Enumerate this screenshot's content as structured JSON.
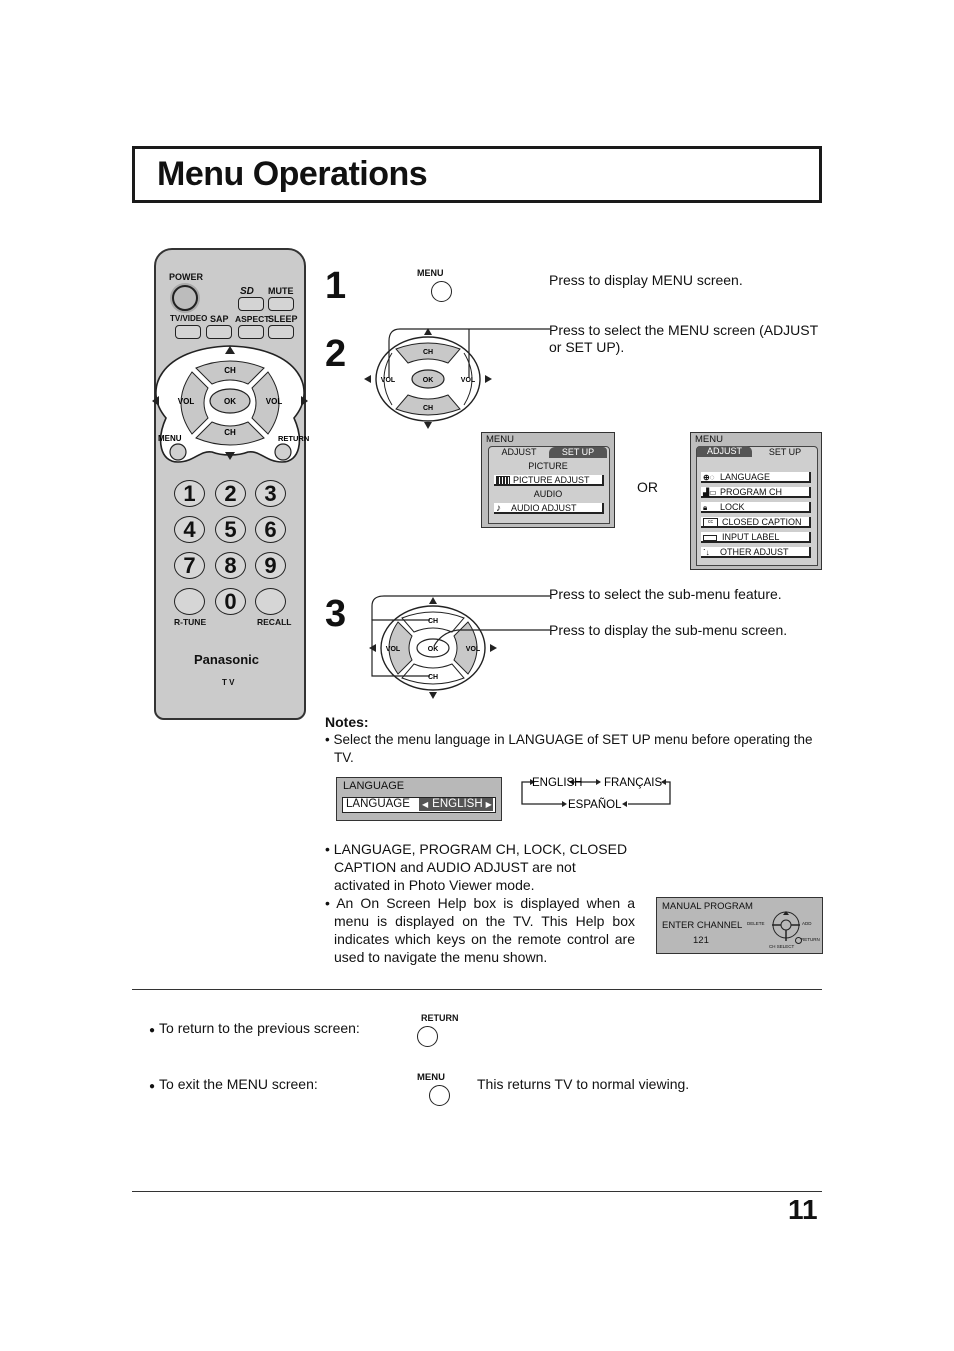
{
  "page": {
    "title": "Menu Operations",
    "page_number": "11"
  },
  "remote": {
    "power": "POWER",
    "sd": "SD",
    "mute": "MUTE",
    "tv_video": "TV/VIDEO",
    "sap": "SAP",
    "aspect": "ASPECT",
    "sleep": "SLEEP",
    "ch": "CH",
    "vol": "VOL",
    "ok": "OK",
    "menu": "MENU",
    "return": "RETURN",
    "digits": [
      "1",
      "2",
      "3",
      "4",
      "5",
      "6",
      "7",
      "8",
      "9",
      "0"
    ],
    "r_tune": "R-TUNE",
    "recall": "RECALL",
    "brand": "Panasonic",
    "model": "T V"
  },
  "steps": [
    {
      "number": "1",
      "button_label": "MENU",
      "description": "Press to display MENU screen."
    },
    {
      "number": "2",
      "description": "Press to select the MENU screen (ADJUST or SET UP)."
    },
    {
      "number": "3",
      "description_1": "Press to select the sub-menu feature.",
      "description_2": "Press to display the sub-menu screen."
    }
  ],
  "dpad": {
    "ch": "CH",
    "vol": "VOL",
    "ok": "OK"
  },
  "adjust_menu": {
    "title": "MENU",
    "tabs": [
      "ADJUST",
      "SET  UP"
    ],
    "sections": [
      {
        "heading": "PICTURE",
        "item": "PICTURE  ADJUST",
        "icon": "picture-icon"
      },
      {
        "heading": "AUDIO",
        "item": "AUDIO  ADJUST",
        "icon": "music-note-icon"
      }
    ]
  },
  "or_label": "OR",
  "setup_menu": {
    "title": "MENU",
    "tabs": [
      "ADJUST",
      "SET  UP"
    ],
    "items": [
      {
        "label": "LANGUAGE",
        "icon": "language-icon"
      },
      {
        "label": "PROGRAM  CH",
        "icon": "program-ch-icon"
      },
      {
        "label": "LOCK",
        "icon": "lock-icon"
      },
      {
        "label": "CLOSED  CAPTION",
        "icon": "cc-icon"
      },
      {
        "label": "INPUT  LABEL",
        "icon": "input-label-icon"
      },
      {
        "label": "OTHER  ADJUST",
        "icon": "other-adjust-icon"
      }
    ]
  },
  "notes": {
    "heading": "Notes:",
    "note1": "• Select the menu language in LANGUAGE of SET UP menu before operating the TV.",
    "language_osd": {
      "title": "LANGUAGE",
      "label": "LANGUAGE",
      "value": "ENGLISH"
    },
    "language_cycle": [
      "ENGLISH",
      "FRANÇAIS",
      "ESPAÑOL"
    ],
    "note2": "• LANGUAGE, PROGRAM CH, LOCK, CLOSED CAPTION and AUDIO ADJUST are not activated in Photo Viewer mode.",
    "note3": "• An On Screen Help box is displayed when a menu is displayed on the TV. This Help box indicates which keys on the remote control are used to navigate the menu shown.",
    "help_osd": {
      "title": "MANUAL  PROGRAM",
      "label": "ENTER  CHANNEL",
      "value": "121",
      "delete": "DELETE",
      "add": "ADD",
      "ch_select": "CH  SELECT",
      "return": "RETURN"
    }
  },
  "footer_actions": [
    {
      "text": "To return to the previous screen:",
      "button_label": "RETURN",
      "extra": ""
    },
    {
      "text": "To exit the MENU screen:",
      "button_label": "MENU",
      "extra": "This returns TV to normal viewing."
    }
  ]
}
